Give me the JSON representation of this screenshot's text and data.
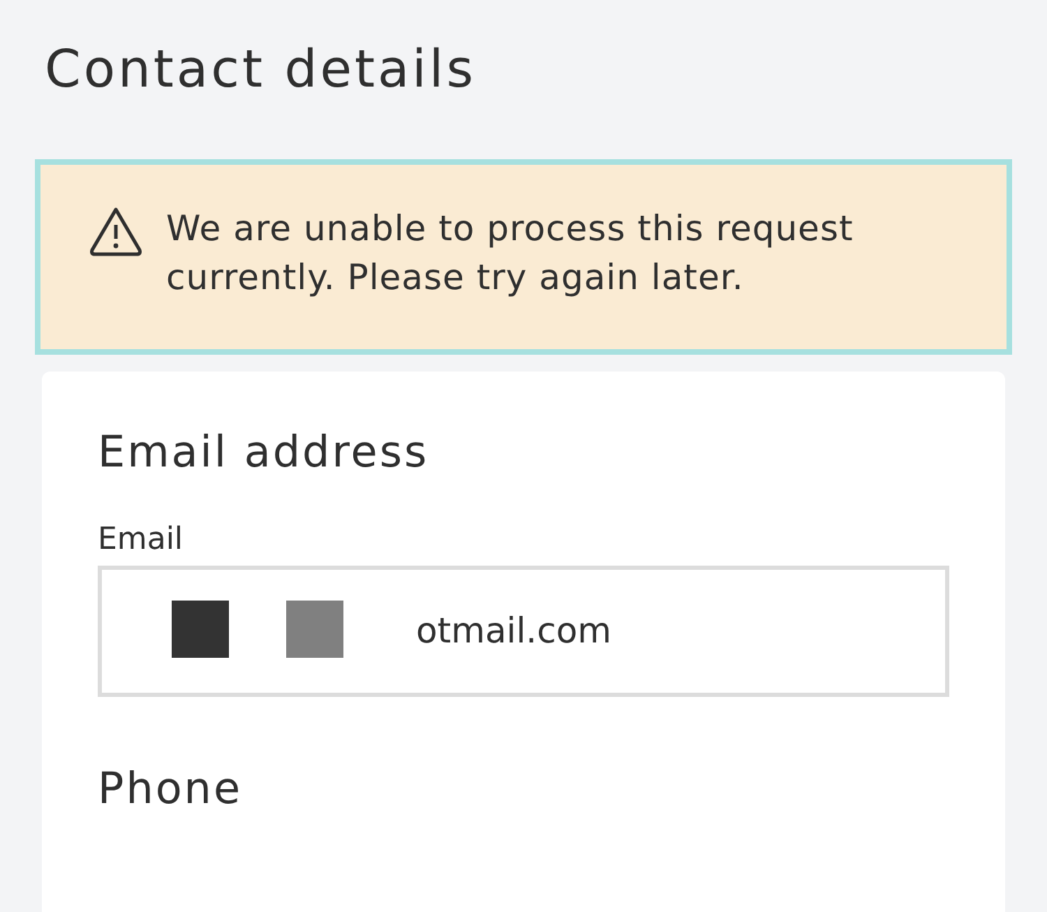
{
  "page": {
    "title": "Contact details"
  },
  "alert": {
    "kind": "warning",
    "message": "We are unable to process this request currently. Please try again later."
  },
  "sections": [
    {
      "heading": "Email address",
      "fields": [
        {
          "label": "Email",
          "value": "otmail.com",
          "redacted": true
        }
      ]
    },
    {
      "heading": "Phone"
    }
  ]
}
